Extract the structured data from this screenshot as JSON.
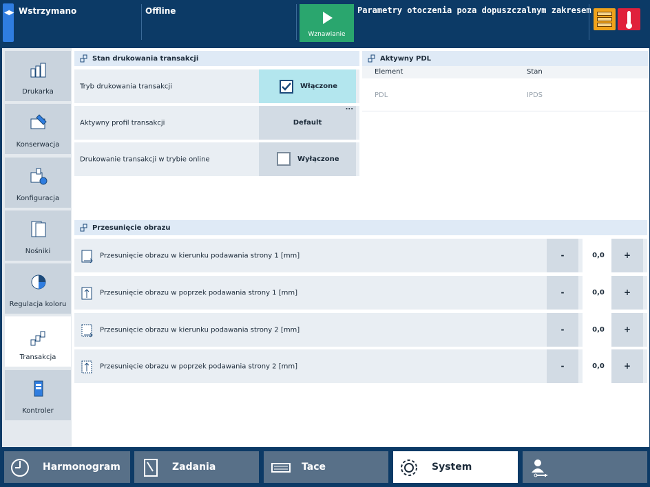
{
  "topbar": {
    "state": "Wstrzymano",
    "connection": "Offline",
    "resume_label": "Wznawianie",
    "message": "Parametry otoczenia poza dopuszczalnym zakresem",
    "colors": {
      "resume": "#2aa66e",
      "server_warning": "#f0a21a",
      "temp_alert": "#e0213b"
    }
  },
  "sidebar": {
    "items": [
      {
        "label": "Drukarka",
        "icon": "printer-icon"
      },
      {
        "label": "Konserwacja",
        "icon": "maintenance-icon"
      },
      {
        "label": "Konfiguracja",
        "icon": "configuration-icon"
      },
      {
        "label": "Nośniki",
        "icon": "media-icon"
      },
      {
        "label": "Regulacja koloru",
        "icon": "color-icon"
      },
      {
        "label": "Transakcja",
        "icon": "transaction-icon",
        "active": true
      },
      {
        "label": "Kontroler",
        "icon": "controller-icon"
      }
    ]
  },
  "transaction": {
    "title": "Stan drukowania transakcji",
    "rows": [
      {
        "label": "Tryb drukowania transakcji",
        "value": "Włączone",
        "checked": true
      },
      {
        "label": "Aktywny profil transakcji",
        "value": "Default",
        "more": "..."
      },
      {
        "label": "Drukowanie transakcji w trybie online",
        "value": "Wyłączone",
        "checked": false
      }
    ]
  },
  "pdl": {
    "title": "Aktywny PDL",
    "col_element": "Element",
    "col_state": "Stan",
    "row_element": "PDL",
    "row_state": "IPDS"
  },
  "shift": {
    "title": "Przesunięcie obrazu",
    "rows": [
      {
        "label": "Przesunięcie obrazu w kierunku podawania strony 1 [mm]",
        "value": "0,0",
        "minus": "-",
        "plus": "+"
      },
      {
        "label": "Przesunięcie obrazu w poprzek podawania strony 1 [mm]",
        "value": "0,0",
        "minus": "-",
        "plus": "+"
      },
      {
        "label": "Przesunięcie obrazu w kierunku podawania strony 2 [mm]",
        "value": "0,0",
        "minus": "-",
        "plus": "+"
      },
      {
        "label": "Przesunięcie obrazu w poprzek podawania strony 2 [mm]",
        "value": "0,0",
        "minus": "-",
        "plus": "+"
      }
    ]
  },
  "bottom_tabs": [
    {
      "label": "Harmonogram",
      "icon": "clock-icon"
    },
    {
      "label": "Zadania",
      "icon": "jobs-icon"
    },
    {
      "label": "Tace",
      "icon": "trays-icon"
    },
    {
      "label": "System",
      "icon": "gear-icon",
      "active": true
    },
    {
      "label": "",
      "icon": "user-key-icon"
    }
  ]
}
